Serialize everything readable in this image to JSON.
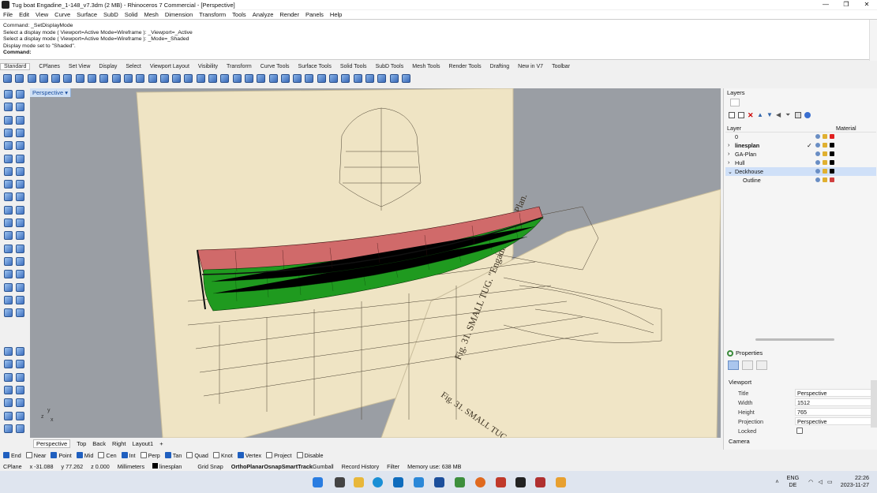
{
  "window": {
    "title": "Tug boat Engadine_1-148_v7.3dm (2 MB) - Rhinoceros 7 Commercial - [Perspective]",
    "controls": [
      "—",
      "❐",
      "✕"
    ]
  },
  "menu": [
    "File",
    "Edit",
    "View",
    "Curve",
    "Surface",
    "SubD",
    "Solid",
    "Mesh",
    "Dimension",
    "Transform",
    "Tools",
    "Analyze",
    "Render",
    "Panels",
    "Help"
  ],
  "command_history": [
    "Command: _SetDisplayMode",
    "Select a display mode ( Viewport=Active  Mode=Wireframe ): _Viewport=_Active",
    "Select a display mode ( Viewport=Active  Mode=Wireframe ): _Mode=_Shaded",
    "Display mode set to \"Shaded\"."
  ],
  "command_prompt": "Command:",
  "toolbar_tabs": [
    "Standard",
    "CPlanes",
    "Set View",
    "Display",
    "Select",
    "Viewport Layout",
    "Visibility",
    "Transform",
    "Curve Tools",
    "Surface Tools",
    "Solid Tools",
    "SubD Tools",
    "Mesh Tools",
    "Render Tools",
    "Drafting",
    "New in V7",
    "Toolbar"
  ],
  "viewport": {
    "name": "Perspective",
    "menu_arrow": "▾",
    "background": "#9a9ea4",
    "axis_labels": [
      "z",
      "y",
      "x"
    ]
  },
  "drawing_text": {
    "fig_left": "Fig. 31. SMALL TUG. \"Engadine\" Lines Plan.",
    "fig_right": "Fig. 31. SMALL TUG. \"Engadine\" Lines Plan."
  },
  "viewport_tabs": [
    "Perspective",
    "Top",
    "Back",
    "Right",
    "Layout1",
    "+"
  ],
  "osnaps": [
    {
      "label": "End",
      "on": true
    },
    {
      "label": "Near",
      "on": false
    },
    {
      "label": "Point",
      "on": true
    },
    {
      "label": "Mid",
      "on": true
    },
    {
      "label": "Cen",
      "on": false
    },
    {
      "label": "Int",
      "on": true
    },
    {
      "label": "Perp",
      "on": false
    },
    {
      "label": "Tan",
      "on": true
    },
    {
      "label": "Quad",
      "on": false
    },
    {
      "label": "Knot",
      "on": false
    },
    {
      "label": "Vertex",
      "on": true
    },
    {
      "label": "Project",
      "on": false
    },
    {
      "label": "Disable",
      "on": false
    }
  ],
  "status": {
    "cplane": "CPlane",
    "x": "x -31.088",
    "y": "y 77.262",
    "z": "z 0.000",
    "units": "Millimeters",
    "layer": "linesplan",
    "grid": "Grid Snap",
    "ortho": "Ortho",
    "planar": "Planar",
    "osnap": "Osnap",
    "smarttrack": "SmartTrack",
    "gumball": "Gumball",
    "history": "Record History",
    "filter": "Filter",
    "memory": "Memory use: 638 MB"
  },
  "layers": {
    "title": "Layers",
    "col_layer": "Layer",
    "col_material": "Material",
    "rows": [
      {
        "name": "0",
        "expand": "",
        "current": false,
        "color": "#e02020",
        "selected": false
      },
      {
        "name": "linesplan",
        "expand": "›",
        "current": true,
        "color": "#000000",
        "selected": false
      },
      {
        "name": "GA-Plan",
        "expand": "›",
        "current": false,
        "color": "#000000",
        "selected": false
      },
      {
        "name": "Hull",
        "expand": "›",
        "current": false,
        "color": "#000000",
        "selected": false
      },
      {
        "name": "Deckhouse",
        "expand": "⌄",
        "current": false,
        "color": "#000000",
        "selected": true
      },
      {
        "name": "Outline",
        "expand": "",
        "current": false,
        "color": "#d04040",
        "selected": false
      }
    ]
  },
  "properties": {
    "title": "Properties",
    "section": "Viewport",
    "fields": [
      {
        "k": "Title",
        "v": "Perspective"
      },
      {
        "k": "Width",
        "v": "1512"
      },
      {
        "k": "Height",
        "v": "765"
      },
      {
        "k": "Projection",
        "v": "Perspective"
      },
      {
        "k": "Locked",
        "v": ""
      }
    ],
    "camera": "Camera"
  },
  "taskbar": {
    "lang": "ENG",
    "lang2": "DE",
    "time": "22:26",
    "date": "2023-11-27"
  }
}
